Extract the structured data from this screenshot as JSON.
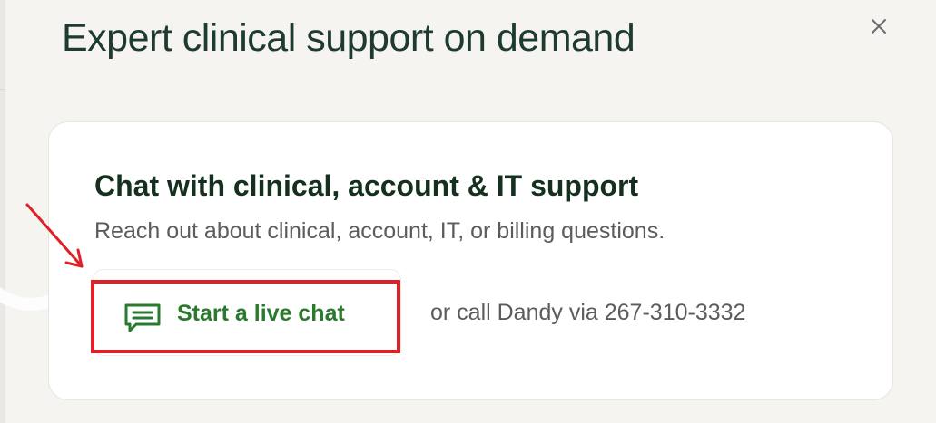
{
  "dialog": {
    "title": "Expert clinical support on demand",
    "close_icon": "close-icon"
  },
  "card": {
    "title": "Chat with clinical, account & IT support",
    "subtitle": "Reach out about clinical, account, IT, or billing questions.",
    "chat_button": {
      "label": "Start a live chat",
      "icon": "chat-bubble-icon"
    },
    "call_text": "or call Dandy via 267-310-3332"
  },
  "annotation": {
    "arrow_icon": "arrow-icon",
    "highlight_color": "#e01f26"
  },
  "colors": {
    "accent": "#2a7a2e",
    "title": "#1d3b2e",
    "highlight": "#e01f26"
  }
}
